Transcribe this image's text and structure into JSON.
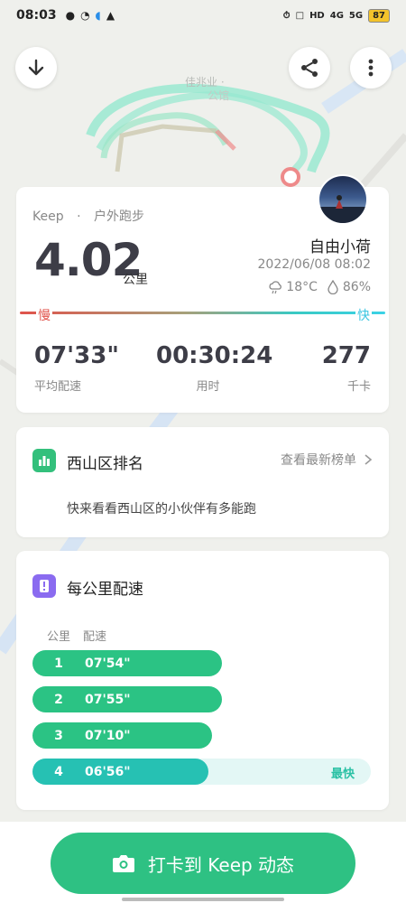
{
  "status_bar": {
    "time": "08:03",
    "left_icons": [
      "wechat-icon",
      "clock-icon",
      "loading-icon",
      "warning-icon"
    ],
    "right_text": [
      "HD",
      "4G",
      "5G"
    ],
    "battery": "87"
  },
  "map": {
    "place_label": "佳兆业 ·",
    "place_label_2": "公馆"
  },
  "summary": {
    "source": "Keep",
    "activity": "户外跑步",
    "distance": "4.02",
    "distance_unit": "公里",
    "username": "自由小荷",
    "datetime": "2022/06/08  08:02",
    "temperature": "18°C",
    "humidity": "86%",
    "slow_label": "慢",
    "fast_label": "快",
    "stats": {
      "pace_value": "07'33\"",
      "pace_label": "平均配速",
      "time_value": "00:30:24",
      "time_label": "用时",
      "cal_value": "277",
      "cal_label": "千卡"
    }
  },
  "rank": {
    "title": "西山区排名",
    "link": "查看最新榜单",
    "description": "快来看看西山区的小伙伴有多能跑"
  },
  "pace": {
    "title": "每公里配速",
    "col_km": "公里",
    "col_pace": "配速",
    "fastest_label": "最快",
    "rows": [
      {
        "km": "1",
        "pace": "07'54\"",
        "fraction": 0.56,
        "fastest": false
      },
      {
        "km": "2",
        "pace": "07'55\"",
        "fraction": 0.56,
        "fastest": false
      },
      {
        "km": "3",
        "pace": "07'10\"",
        "fraction": 0.53,
        "fastest": false
      },
      {
        "km": "4",
        "pace": "06'56\"",
        "fraction": 0.52,
        "fastest": true
      }
    ]
  },
  "bottom": {
    "checkin_label": "打卡到 Keep 动态"
  },
  "colors": {
    "accent_green": "#2ec183",
    "slow_red": "#e0534b",
    "fast_cyan": "#3bc6e0"
  }
}
